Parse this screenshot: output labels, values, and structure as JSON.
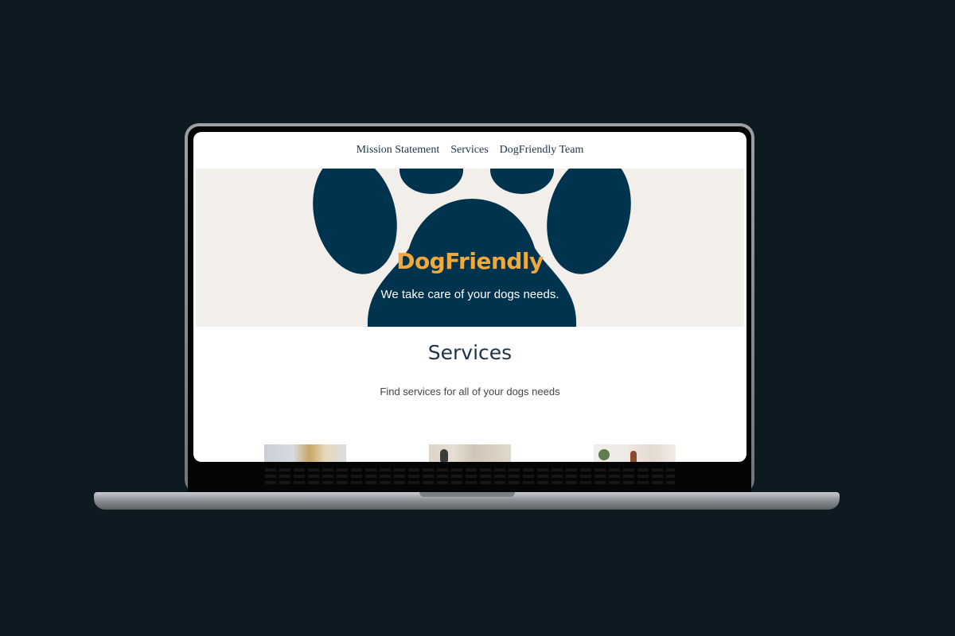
{
  "nav": {
    "items": [
      "Mission Statement",
      "Services",
      "DogFriendly Team"
    ]
  },
  "hero": {
    "title": "DogFriendly",
    "subtitle": "We take care of your dogs needs."
  },
  "services": {
    "heading": "Services",
    "subheading": "Find services for all of your dogs needs"
  },
  "colors": {
    "page_background": "#0e1a22",
    "brand_navy": "#00334d",
    "brand_orange": "#f2a93b",
    "hero_background": "#f2efea",
    "text_dark": "#1e3348"
  },
  "icons": {
    "hero_graphic": "paw-print-icon"
  }
}
